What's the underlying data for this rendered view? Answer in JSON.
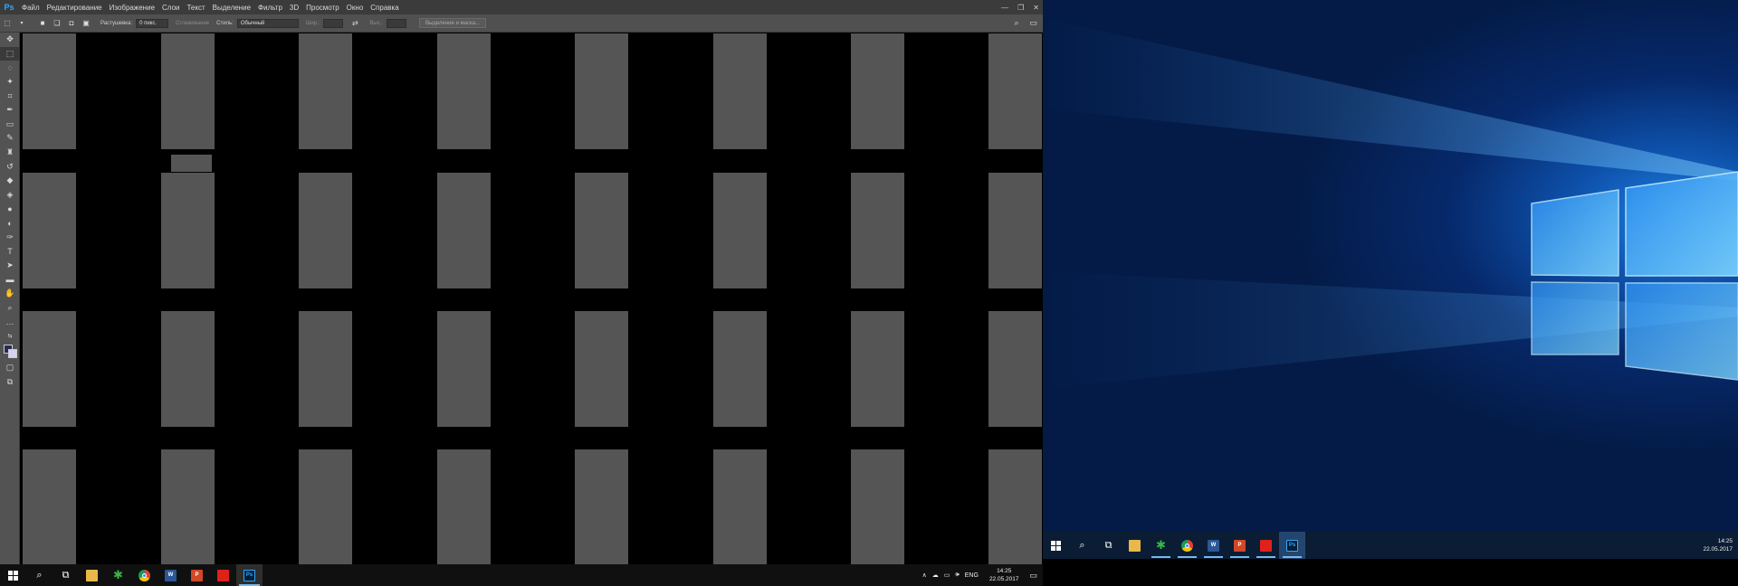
{
  "photoshop": {
    "logo": "Ps",
    "menu": [
      "Файл",
      "Редактирование",
      "Изображение",
      "Слои",
      "Текст",
      "Выделение",
      "Фильтр",
      "3D",
      "Просмотр",
      "Окно",
      "Справка"
    ],
    "window_controls": {
      "minimize": "—",
      "restore": "❐",
      "close": "✕"
    },
    "options": {
      "feather_label": "Растушевка:",
      "feather_value": "0 пикс.",
      "antialias_label": "Сглаживание",
      "style_label": "Стиль:",
      "style_value": "Обычный",
      "width_label": "Шир.:",
      "height_label": "Выс.:",
      "select_mask_button": "Выделение и маска..."
    },
    "canvas_pattern_color": "#555555",
    "canvas_background": "#000000"
  },
  "taskbar_left": {
    "apps": [
      {
        "name": "start",
        "icon": "windows-icon"
      },
      {
        "name": "search",
        "icon": "search-icon"
      },
      {
        "name": "task-view",
        "icon": "task-view-icon"
      },
      {
        "name": "explorer",
        "icon": "folder-icon"
      },
      {
        "name": "green-app",
        "icon": "green-star-icon"
      },
      {
        "name": "chrome",
        "icon": "chrome-icon"
      },
      {
        "name": "word",
        "icon": "word-icon",
        "label": "W"
      },
      {
        "name": "powerpoint",
        "icon": "powerpoint-icon",
        "label": "P"
      },
      {
        "name": "red-app",
        "icon": "red-app-icon"
      },
      {
        "name": "photoshop",
        "icon": "photoshop-icon",
        "label": "Ps",
        "active": true
      }
    ],
    "tray": {
      "language": "ENG",
      "time": "14:25",
      "date": "22.05.2017"
    }
  },
  "taskbar_right": {
    "time": "14:25",
    "date": "22.05.2017"
  },
  "colors": {
    "photoshop_blue": "#31a8ff",
    "taskbar_accent": "#76b9ed",
    "word": "#2b5797",
    "powerpoint": "#d24726",
    "red_app": "#e0211b",
    "green_app": "#3ab54a"
  }
}
